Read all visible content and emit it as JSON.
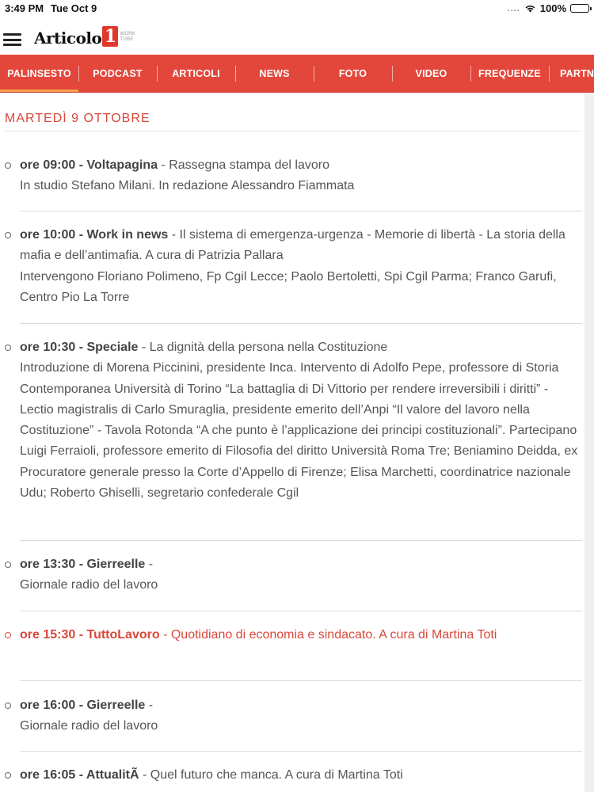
{
  "status_bar": {
    "time": "3:49 PM",
    "date": "Tue Oct 9",
    "signal": "....",
    "battery": "100%"
  },
  "header": {
    "logo_text": "Articolo",
    "logo_number": "1",
    "logo_sub": "WORK TUBE"
  },
  "nav": {
    "tabs": [
      {
        "label": "PALINSESTO"
      },
      {
        "label": "PODCAST"
      },
      {
        "label": "ARTICOLI"
      },
      {
        "label": "NEWS"
      },
      {
        "label": "FOTO"
      },
      {
        "label": "VIDEO"
      },
      {
        "label": "FREQUENZE"
      },
      {
        "label": "PARTN"
      }
    ],
    "active": "PALINSESTO"
  },
  "colors": {
    "accent": "#e3473b",
    "active_indicator": "#f5a04a",
    "highlight_text": "#d9473a"
  },
  "schedule": {
    "day": "MARTEDÌ 9 OTTOBRE",
    "entries": [
      {
        "time_title": "ore 09:00 - Voltapagina",
        "description": " - Rassegna stampa del lavoro",
        "details": "In studio Stefano Milani. In redazione Alessandro Fiammata"
      },
      {
        "time_title": "ore 10:00 - Work in news",
        "description": " - Il sistema di emergenza-urgenza - Memorie di libertà - La storia della mafia e dell’antimafia. A cura di Patrizia Pallara",
        "details": "Intervengono Floriano Polimeno, Fp Cgil Lecce; Paolo Bertoletti, Spi Cgil Parma; Franco Garufi, Centro Pio La Torre"
      },
      {
        "time_title": "ore 10:30 - Speciale",
        "description": " - La dignità della persona nella Costituzione",
        "details": "Introduzione di Morena Piccinini, presidente Inca. Intervento di Adolfo Pepe, professore di Storia Contemporanea Università di Torino “La battaglia di Di Vittorio per rendere irreversibili i diritti” - Lectio magistralis di Carlo Smuraglia, presidente emerito dell’Anpi “Il valore del lavoro nella Costituzione” - Tavola Rotonda “A che punto è l’applicazione dei principi costituzionali”. Partecipano Luigi Ferraioli, professore emerito di Filosofia del diritto Università Roma Tre; Beniamino Deidda, ex Procuratore generale presso la Corte d’Appello di Firenze; Elisa Marchetti, coordinatrice nazionale Udu; Roberto Ghiselli, segretario confederale Cgil"
      },
      {
        "time_title": "ore 13:30 - Gierreelle",
        "description": " -",
        "details": "Giornale radio del lavoro"
      },
      {
        "time_title": "ore 15:30 - TuttoLavoro",
        "description": " - Quotidiano di economia e sindacato. A cura di Martina Toti",
        "details": "",
        "current": true
      },
      {
        "time_title": "ore 16:00 - Gierreelle",
        "description": " -",
        "details": "Giornale radio del lavoro"
      },
      {
        "time_title": "ore 16:05 - AttualitÃ",
        "description": " - Quel futuro che manca. A cura di Martina Toti",
        "details": ""
      }
    ]
  }
}
